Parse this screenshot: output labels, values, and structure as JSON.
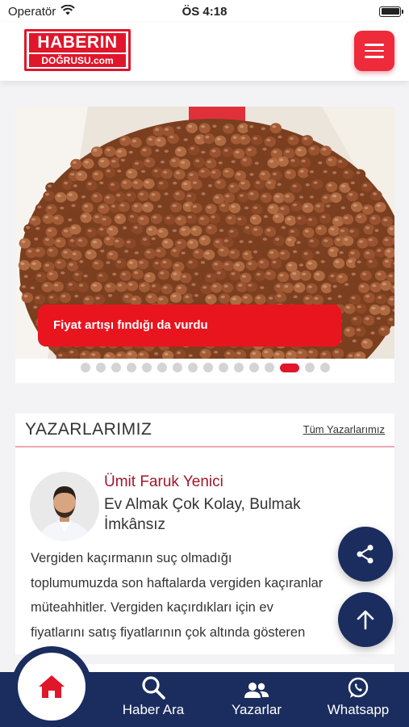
{
  "status": {
    "carrier": "Operatör",
    "time": "ÖS 4:18"
  },
  "header": {
    "logo_top": "HABERIN",
    "logo_bottom": "DOĞRUSU.com"
  },
  "slider": {
    "caption": "Fiyat artışı fındığı da vurdu",
    "dot_count": 16,
    "active_index": 13
  },
  "writers": {
    "title": "YAZARLARIMIZ",
    "all_link": "Tüm Yazarlarımız",
    "author": "Ümit Faruk Yenici",
    "headline": "Ev Almak Çok Kolay, Bulmak İmkânsız",
    "excerpt_lines": [
      "Vergiden kaçırmanın suç olmadığı",
      "toplumumuzda son haftalarda vergiden kaçıranlar",
      "müteahhitler. Vergiden kaçırdıkları için ev",
      "fiyatlarını satış fiyatlarının çok altında gösteren"
    ]
  },
  "nav": {
    "search": "Haber Ara",
    "writers": "Yazarlar",
    "whatsapp": "Whatsapp"
  },
  "colors": {
    "brand_red": "#e0162b",
    "navy": "#1b2d5e",
    "author_red": "#a3162a"
  }
}
